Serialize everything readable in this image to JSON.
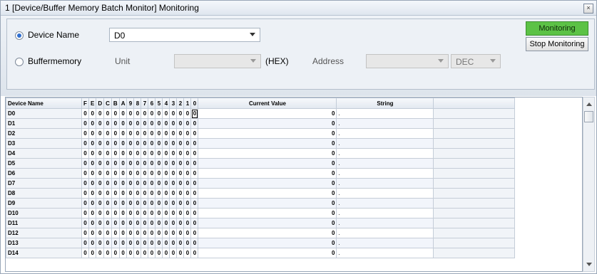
{
  "window": {
    "title": "1 [Device/Buffer Memory Batch Monitor] Monitoring",
    "close_glyph": "×"
  },
  "device": {
    "radio_label": "Device Name",
    "value": "D0"
  },
  "buffer": {
    "radio_label": "Buffermemory",
    "unit_label": "Unit",
    "unit_value": "",
    "hex_label": "(HEX)",
    "address_label": "Address",
    "address_value": "",
    "format_value": "DEC"
  },
  "buttons": {
    "monitoring": "Monitoring",
    "stop": "Stop Monitoring"
  },
  "colors": {
    "monitoring_button": "#5cc246",
    "radio_selected": "#2f6fd1"
  },
  "grid": {
    "headers": {
      "device_name": "Device Name",
      "current_value": "Current Value",
      "string": "String"
    },
    "bit_headers": [
      "F",
      "E",
      "D",
      "C",
      "B",
      "A",
      "9",
      "8",
      "7",
      "6",
      "5",
      "4",
      "3",
      "2",
      "1",
      "0"
    ],
    "rows": [
      {
        "name": "D0",
        "bits": [
          "0",
          "0",
          "0",
          "0",
          "0",
          "0",
          "0",
          "0",
          "0",
          "0",
          "0",
          "0",
          "0",
          "0",
          "0",
          "0"
        ],
        "value": "0",
        "string": "."
      },
      {
        "name": "D1",
        "bits": [
          "0",
          "0",
          "0",
          "0",
          "0",
          "0",
          "0",
          "0",
          "0",
          "0",
          "0",
          "0",
          "0",
          "0",
          "0",
          "0"
        ],
        "value": "0",
        "string": "."
      },
      {
        "name": "D2",
        "bits": [
          "0",
          "0",
          "0",
          "0",
          "0",
          "0",
          "0",
          "0",
          "0",
          "0",
          "0",
          "0",
          "0",
          "0",
          "0",
          "0"
        ],
        "value": "0",
        "string": "."
      },
      {
        "name": "D3",
        "bits": [
          "0",
          "0",
          "0",
          "0",
          "0",
          "0",
          "0",
          "0",
          "0",
          "0",
          "0",
          "0",
          "0",
          "0",
          "0",
          "0"
        ],
        "value": "0",
        "string": "."
      },
      {
        "name": "D4",
        "bits": [
          "0",
          "0",
          "0",
          "0",
          "0",
          "0",
          "0",
          "0",
          "0",
          "0",
          "0",
          "0",
          "0",
          "0",
          "0",
          "0"
        ],
        "value": "0",
        "string": "."
      },
      {
        "name": "D5",
        "bits": [
          "0",
          "0",
          "0",
          "0",
          "0",
          "0",
          "0",
          "0",
          "0",
          "0",
          "0",
          "0",
          "0",
          "0",
          "0",
          "0"
        ],
        "value": "0",
        "string": "."
      },
      {
        "name": "D6",
        "bits": [
          "0",
          "0",
          "0",
          "0",
          "0",
          "0",
          "0",
          "0",
          "0",
          "0",
          "0",
          "0",
          "0",
          "0",
          "0",
          "0"
        ],
        "value": "0",
        "string": "."
      },
      {
        "name": "D7",
        "bits": [
          "0",
          "0",
          "0",
          "0",
          "0",
          "0",
          "0",
          "0",
          "0",
          "0",
          "0",
          "0",
          "0",
          "0",
          "0",
          "0"
        ],
        "value": "0",
        "string": "."
      },
      {
        "name": "D8",
        "bits": [
          "0",
          "0",
          "0",
          "0",
          "0",
          "0",
          "0",
          "0",
          "0",
          "0",
          "0",
          "0",
          "0",
          "0",
          "0",
          "0"
        ],
        "value": "0",
        "string": "."
      },
      {
        "name": "D9",
        "bits": [
          "0",
          "0",
          "0",
          "0",
          "0",
          "0",
          "0",
          "0",
          "0",
          "0",
          "0",
          "0",
          "0",
          "0",
          "0",
          "0"
        ],
        "value": "0",
        "string": "."
      },
      {
        "name": "D10",
        "bits": [
          "0",
          "0",
          "0",
          "0",
          "0",
          "0",
          "0",
          "0",
          "0",
          "0",
          "0",
          "0",
          "0",
          "0",
          "0",
          "0"
        ],
        "value": "0",
        "string": "."
      },
      {
        "name": "D11",
        "bits": [
          "0",
          "0",
          "0",
          "0",
          "0",
          "0",
          "0",
          "0",
          "0",
          "0",
          "0",
          "0",
          "0",
          "0",
          "0",
          "0"
        ],
        "value": "0",
        "string": "."
      },
      {
        "name": "D12",
        "bits": [
          "0",
          "0",
          "0",
          "0",
          "0",
          "0",
          "0",
          "0",
          "0",
          "0",
          "0",
          "0",
          "0",
          "0",
          "0",
          "0"
        ],
        "value": "0",
        "string": "."
      },
      {
        "name": "D13",
        "bits": [
          "0",
          "0",
          "0",
          "0",
          "0",
          "0",
          "0",
          "0",
          "0",
          "0",
          "0",
          "0",
          "0",
          "0",
          "0",
          "0"
        ],
        "value": "0",
        "string": "."
      },
      {
        "name": "D14",
        "bits": [
          "0",
          "0",
          "0",
          "0",
          "0",
          "0",
          "0",
          "0",
          "0",
          "0",
          "0",
          "0",
          "0",
          "0",
          "0",
          "0"
        ],
        "value": "0",
        "string": "."
      }
    ]
  }
}
